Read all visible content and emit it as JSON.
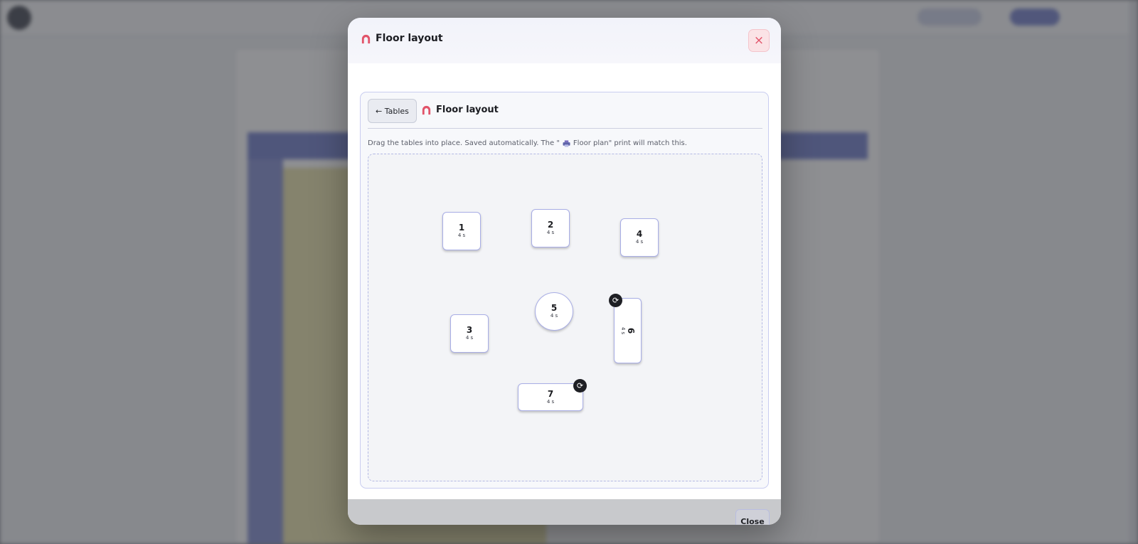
{
  "modal": {
    "title": "Floor layout",
    "close_icon": "×",
    "back_button": "← Tables",
    "inner_title": "Floor layout",
    "hint_before": "Drag the tables into place. Saved automatically. The \"",
    "hint_after": " Floor plan\" print will match this.",
    "footer_close": "Close"
  },
  "icons": {
    "title_icon": "arch-icon",
    "hint_icon": "printer-icon",
    "rotate_icon": "rotate-icon"
  },
  "colors": {
    "accent": "#e2546a",
    "table_border": "#a9aee6",
    "canvas_border": "#b4b9e4"
  },
  "tables": [
    {
      "number": "1",
      "seats": "4 s",
      "shape": "square"
    },
    {
      "number": "2",
      "seats": "4 s",
      "shape": "square"
    },
    {
      "number": "4",
      "seats": "4 s",
      "shape": "square"
    },
    {
      "number": "5",
      "seats": "4 s",
      "shape": "round"
    },
    {
      "number": "3",
      "seats": "4 s",
      "shape": "square"
    },
    {
      "number": "6",
      "seats": "4 s",
      "shape": "rectangle",
      "rotated": true
    },
    {
      "number": "7",
      "seats": "4 s",
      "shape": "rectangle"
    }
  ],
  "rotate_glyph": "⟳"
}
